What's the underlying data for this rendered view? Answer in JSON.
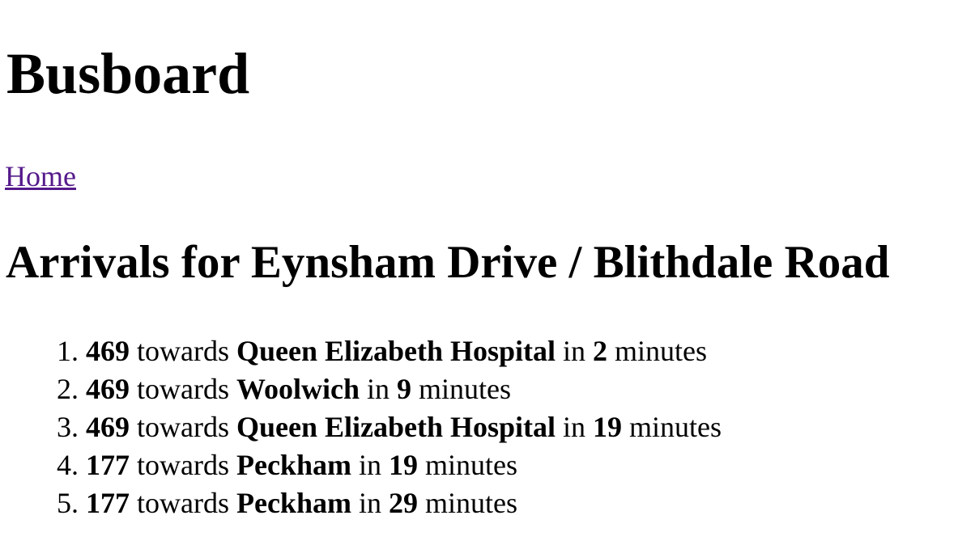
{
  "page": {
    "title": "Busboard",
    "nav": {
      "home_label": "Home"
    },
    "heading": "Arrivals for Eynsham Drive / Blithdale Road",
    "connector_towards": "towards",
    "connector_in": "in",
    "unit_minutes": "minutes"
  },
  "arrivals": [
    {
      "route": "469",
      "destination": "Queen Elizabeth Hospital",
      "minutes": "2"
    },
    {
      "route": "469",
      "destination": "Woolwich",
      "minutes": "9"
    },
    {
      "route": "469",
      "destination": "Queen Elizabeth Hospital",
      "minutes": "19"
    },
    {
      "route": "177",
      "destination": "Peckham",
      "minutes": "19"
    },
    {
      "route": "177",
      "destination": "Peckham",
      "minutes": "29"
    }
  ]
}
